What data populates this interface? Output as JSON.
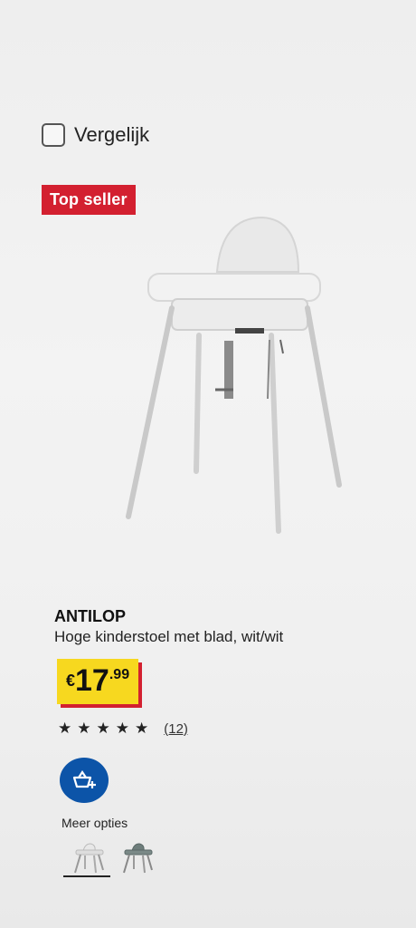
{
  "compare": {
    "label": "Vergelijk",
    "checked": false
  },
  "badge": {
    "label": "Top seller",
    "color": "#d32030"
  },
  "product": {
    "image_icon": "high-chair-icon",
    "name": "ANTILOP",
    "description": "Hoge kinderstoel met blad, wit/wit",
    "price": {
      "currency": "€",
      "main": "17",
      "decimals": ".99",
      "highlight_color": "#f7d81f"
    },
    "rating": {
      "stars": 5,
      "review_count": "(12)"
    }
  },
  "cart_button": {
    "icon": "add-to-cart-icon",
    "color": "#0c54a8"
  },
  "more_options": {
    "label": "Meer opties",
    "variants": [
      {
        "icon": "high-chair-white-icon",
        "selected": true
      },
      {
        "icon": "high-chair-grey-icon",
        "selected": false
      }
    ]
  }
}
